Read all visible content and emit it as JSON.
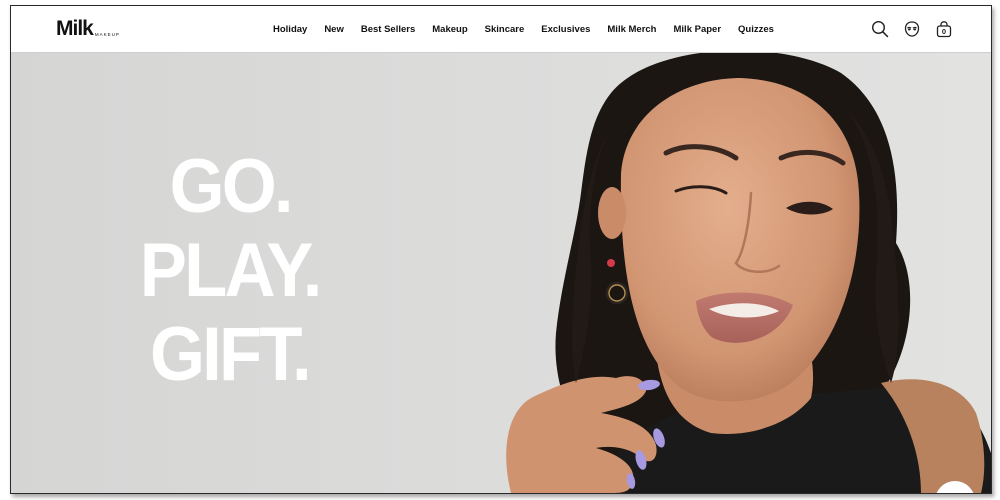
{
  "brand": {
    "name": "Milk",
    "sub": "MAKEUP"
  },
  "nav": {
    "items": [
      {
        "label": "Holiday"
      },
      {
        "label": "New"
      },
      {
        "label": "Best Sellers"
      },
      {
        "label": "Makeup"
      },
      {
        "label": "Skincare"
      },
      {
        "label": "Exclusives"
      },
      {
        "label": "Milk Merch"
      },
      {
        "label": "Milk Paper"
      },
      {
        "label": "Quizzes"
      }
    ],
    "icons": [
      "search-icon",
      "account-icon",
      "cart-icon"
    ],
    "cart_count": "0"
  },
  "hero": {
    "lines": [
      "GO.",
      "PLAY.",
      "GIFT."
    ]
  },
  "colors": {
    "background": "#dcdcdb",
    "headline": "#ffffff",
    "text": "#111111",
    "nail": "#a89ae0",
    "hair": "#1c1613",
    "skin": "#d49a78",
    "top": "#1a1a1a"
  }
}
